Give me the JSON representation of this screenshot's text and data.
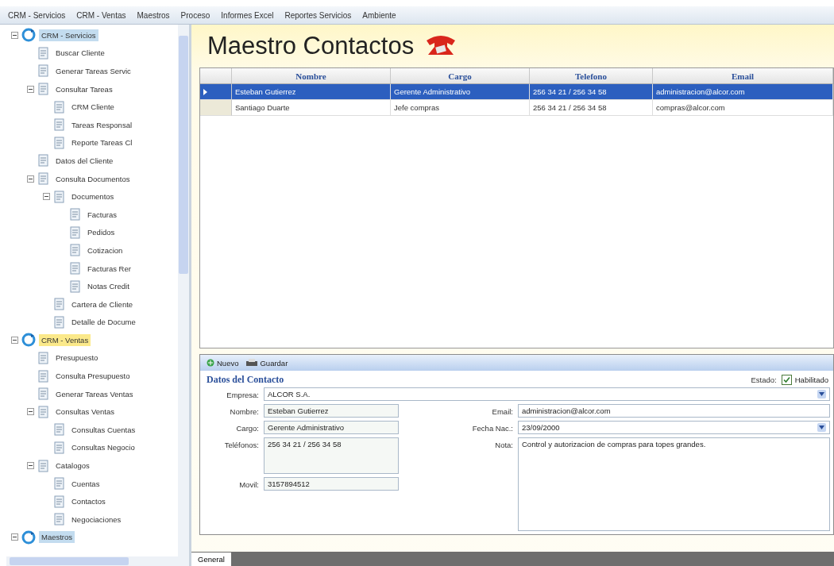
{
  "menu": [
    {
      "label": "CRM - Servicios"
    },
    {
      "label": "CRM - Ventas"
    },
    {
      "label": "Maestros"
    },
    {
      "label": "Proceso"
    },
    {
      "label": "Informes Excel"
    },
    {
      "label": "Reportes Servicios"
    },
    {
      "label": "Ambiente"
    }
  ],
  "tree": [
    {
      "label": "CRM - Servicios",
      "selected": true,
      "hot": false,
      "expanded": true,
      "children": [
        {
          "label": "Buscar Cliente",
          "selected": false,
          "hot": false
        },
        {
          "label": "Generar Tareas Servic",
          "selected": false,
          "hot": false
        },
        {
          "label": "Consultar Tareas",
          "selected": false,
          "hot": false,
          "expanded": true,
          "children": [
            {
              "label": "CRM Cliente",
              "selected": false,
              "hot": false
            },
            {
              "label": "Tareas Responsal",
              "selected": false,
              "hot": false
            },
            {
              "label": "Reporte Tareas Cl",
              "selected": false,
              "hot": false
            }
          ]
        },
        {
          "label": "Datos del Cliente",
          "selected": false,
          "hot": false
        },
        {
          "label": "Consulta Documentos",
          "selected": false,
          "hot": false,
          "expanded": true,
          "children": [
            {
              "label": "Documentos",
              "selected": false,
              "hot": false,
              "expanded": true,
              "children": [
                {
                  "label": "Facturas",
                  "selected": false,
                  "hot": false
                },
                {
                  "label": "Pedidos",
                  "selected": false,
                  "hot": false
                },
                {
                  "label": "Cotizacion",
                  "selected": false,
                  "hot": false
                },
                {
                  "label": "Facturas Rer",
                  "selected": false,
                  "hot": false
                },
                {
                  "label": "Notas Credit",
                  "selected": false,
                  "hot": false
                }
              ]
            },
            {
              "label": "Cartera de Cliente",
              "selected": false,
              "hot": false
            },
            {
              "label": "Detalle de Docume",
              "selected": false,
              "hot": false
            }
          ]
        }
      ]
    },
    {
      "label": "CRM - Ventas",
      "selected": false,
      "hot": true,
      "expanded": true,
      "children": [
        {
          "label": "Presupuesto",
          "selected": false,
          "hot": false
        },
        {
          "label": "Consulta Presupuesto",
          "selected": false,
          "hot": false
        },
        {
          "label": "Generar Tareas Ventas",
          "selected": false,
          "hot": false
        },
        {
          "label": "Consultas Ventas",
          "selected": false,
          "hot": false,
          "expanded": true,
          "children": [
            {
              "label": "Consultas Cuentas",
              "selected": false,
              "hot": false
            },
            {
              "label": "Consultas Negocio",
              "selected": false,
              "hot": false
            }
          ]
        },
        {
          "label": "Catalogos",
          "selected": false,
          "hot": false,
          "expanded": true,
          "children": [
            {
              "label": "Cuentas",
              "selected": false,
              "hot": false
            },
            {
              "label": "Contactos",
              "selected": false,
              "hot": false
            },
            {
              "label": "Negociaciones",
              "selected": false,
              "hot": false
            }
          ]
        }
      ]
    },
    {
      "label": "Maestros",
      "selected": true,
      "hot": false,
      "expanded": true
    }
  ],
  "header": {
    "title": "Maestro Contactos"
  },
  "table": {
    "columns": [
      "Nombre",
      "Cargo",
      "Telefono",
      "Email"
    ],
    "rows": [
      {
        "selected": true,
        "cells": [
          "Esteban Gutierrez",
          "Gerente Administrativo",
          "256 34 21 / 256 34 58",
          "administracion@alcor.com"
        ]
      },
      {
        "selected": false,
        "cells": [
          "Santiago Duarte",
          "Jefe compras",
          "256 34 21 / 256 34 58",
          "compras@alcor.com"
        ]
      }
    ]
  },
  "toolbar": [
    {
      "label": "Nuevo",
      "kind": "new"
    },
    {
      "label": "Guardar",
      "kind": "save"
    }
  ],
  "form": {
    "title": "Datos del Contacto",
    "status_label": "Estado:",
    "status": {
      "label": "Habilitado",
      "checked": true
    },
    "top": {
      "label": "Empresa:",
      "value": "ALCOR S.A.",
      "kind": "dropdown"
    },
    "left": [
      {
        "label": "Nombre:",
        "value": "Esteban Gutierrez",
        "kind": "text"
      },
      {
        "label": "Cargo:",
        "value": "Gerente Administrativo",
        "kind": "text"
      },
      {
        "label": "Teléfonos:",
        "value": "256 34 21 / 256 34 58",
        "kind": "multiline"
      },
      {
        "label": "Movil:",
        "value": "3157894512",
        "kind": "text"
      }
    ],
    "right": [
      {
        "label": "Email:",
        "value": "administracion@alcor.com",
        "kind": "text"
      },
      {
        "label": "Fecha Nac.:",
        "value": "23/09/2000",
        "kind": "dropdown"
      },
      {
        "label": "Nota:",
        "value": "Control y autorizacion de compras para topes grandes.",
        "kind": "multiline"
      }
    ]
  },
  "bottom_tabs": [
    {
      "label": "General",
      "selected": true
    }
  ]
}
